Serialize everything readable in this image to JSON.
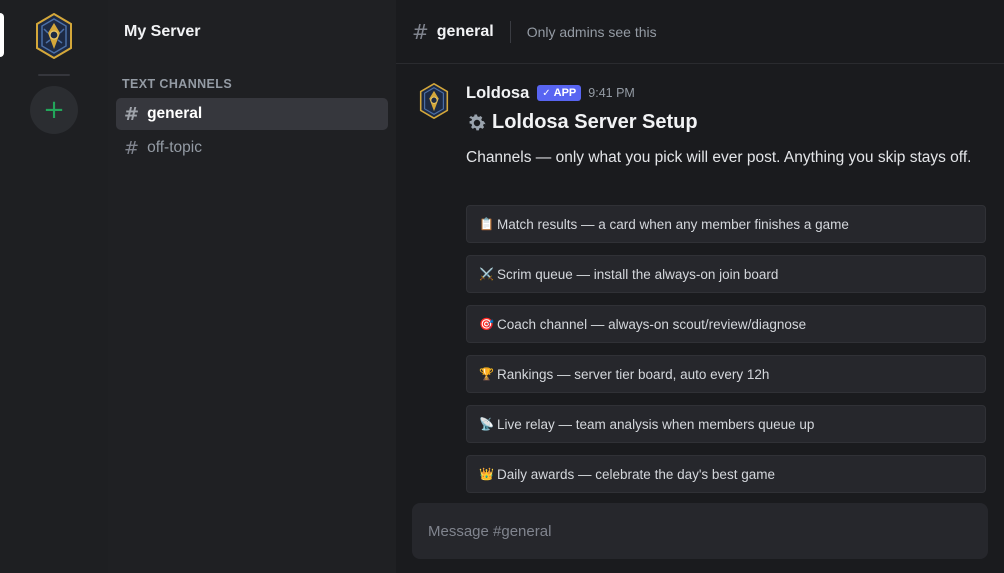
{
  "server": {
    "name": "My Server",
    "add_label": "+"
  },
  "sidebar": {
    "category": "TEXT CHANNELS",
    "channels": [
      {
        "name": "general",
        "active": true
      },
      {
        "name": "off-topic",
        "active": false
      }
    ]
  },
  "topbar": {
    "channel": "general",
    "topic": "Only admins see this"
  },
  "message": {
    "author": "Loldosa",
    "badge": "APP",
    "time": "9:41 PM",
    "title": "Loldosa Server Setup",
    "description": "Channels — only what you pick will ever post. Anything you skip stays off.",
    "options": [
      {
        "emoji": "📋",
        "label": "Match results — a card when any member finishes a game"
      },
      {
        "emoji": "⚔️",
        "label": "Scrim queue — install the always-on join board"
      },
      {
        "emoji": "🎯",
        "label": "Coach channel — always-on scout/review/diagnose"
      },
      {
        "emoji": "🏆",
        "label": "Rankings — server tier board, auto every 12h"
      },
      {
        "emoji": "📡",
        "label": "Live relay — team analysis when members queue up"
      },
      {
        "emoji": "👑",
        "label": "Daily awards — celebrate the day's best game"
      }
    ]
  },
  "composer": {
    "placeholder": "Message #general"
  },
  "colors": {
    "accent": "#5865f2",
    "add_green": "#23a55a",
    "emblem_gold": "#d4a73a",
    "emblem_navy": "#1d2a44"
  }
}
